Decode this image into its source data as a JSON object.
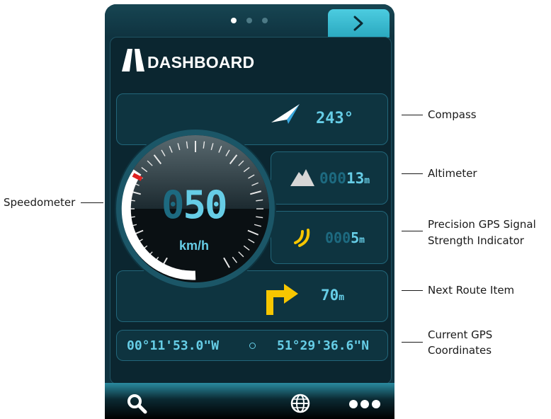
{
  "pager": {
    "dots": 3,
    "active_index": 0
  },
  "header": {
    "title": "DASHBOARD",
    "next_icon": "chevron-right-icon"
  },
  "compass": {
    "value": "243°",
    "icon": "compass-arrow-icon"
  },
  "altimeter": {
    "value_dim": "000",
    "value_bright": "13",
    "unit": "m",
    "icon": "mountain-icon"
  },
  "gps_signal": {
    "value_dim": "000",
    "value_bright": "5",
    "unit": "m",
    "icon": "signal-waves-icon"
  },
  "speed": {
    "value_dim": "0",
    "value_bright": "50",
    "unit": "km/h"
  },
  "route": {
    "value": "70",
    "unit": "m",
    "icon": "turn-right-arrow-icon"
  },
  "coords": {
    "longitude": "00°11'53.0\"W",
    "latitude": "51°29'36.6\"N"
  },
  "bottom_bar": {
    "icons": [
      "search-icon",
      "globe-icon",
      "more-icon"
    ]
  },
  "callouts": {
    "compass": "Compass",
    "altimeter": "Altimeter",
    "gps_signal_line1": "Precision GPS Signal",
    "gps_signal_line2": "Strength Indicator",
    "next_route": "Next Route Item",
    "coords_line1": "Current GPS",
    "coords_line2": "Coordinates",
    "speedometer": "Speedometer"
  },
  "colors": {
    "accent": "#66cde6",
    "panel": "#0e3440",
    "route_arrow": "#f7c600",
    "signal": "#f7c600",
    "needle": "#e02020"
  }
}
